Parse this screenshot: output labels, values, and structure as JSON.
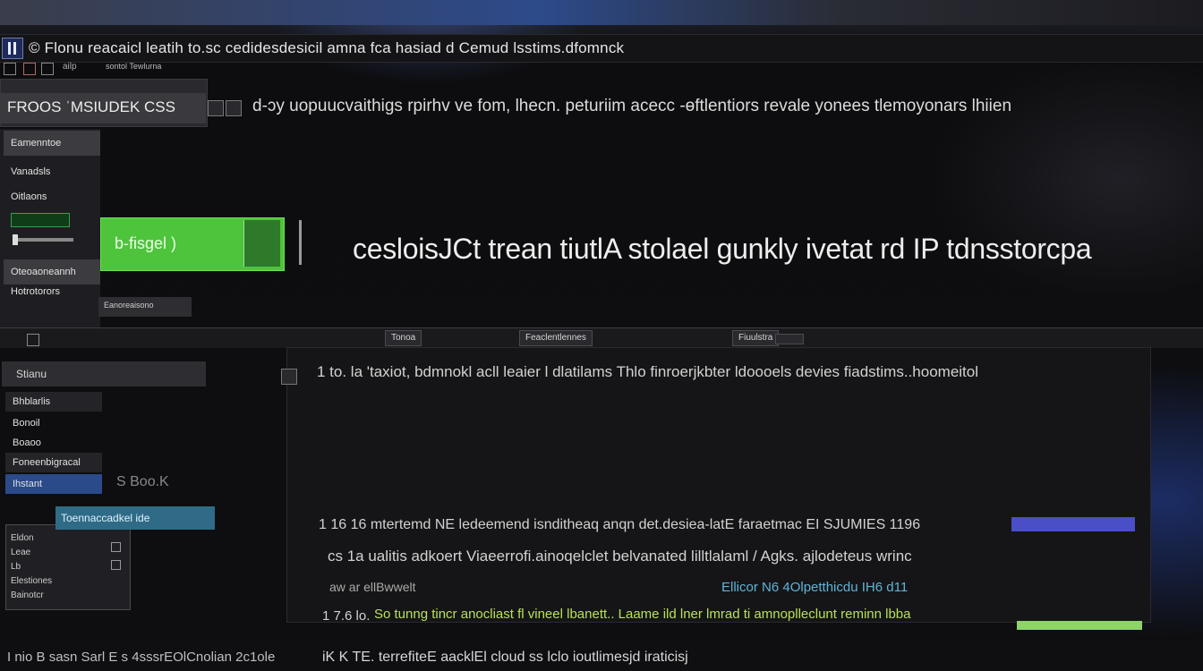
{
  "window": {
    "title": "© Flonu reacaicl leatih to.sc cedidesdesicil amna fca hasiad d Cemud lsstims.dfomnck"
  },
  "toolbar": {
    "sub_label": "sontol Tewlurna",
    "tag": "ailp",
    "title_box": "FROOS ˈMSIUDEK CSS"
  },
  "header": {
    "text": "d-ɔy uopuucvaithigs rpirhv ve fom, lhecn. peturiim acecc -ɵftlentiors revale yonees tlemoyonars lhiien"
  },
  "sidebar1": {
    "items": [
      "Eamenntoe",
      "Vanadsls",
      "Oitlaons",
      "Oteoaoneannh",
      "Hotrotorors"
    ],
    "strip_label": "Eanoreaisono"
  },
  "primary": {
    "button_label": "b-fisgel  )",
    "headline": "cesloisJCt  trean tiutlA stolael gunkly ivetat  rd  IP tdnsstorcpa"
  },
  "tabs": [
    "Tonoa",
    "Feaclentlennes",
    "Fiuulstra"
  ],
  "sidebar2": {
    "head": "Stianu",
    "items": [
      "Bhblarlis",
      "Bonoil",
      "Boaoo",
      "Foneenbigracal",
      "Ihstant"
    ],
    "badge": "S Boo.K"
  },
  "dropdown": {
    "teal_label": "Toennaccadkel ide",
    "items": [
      "Eldon",
      "Leae",
      "Lb",
      "Elestiones",
      "Bainotcr"
    ]
  },
  "main": {
    "line1": "1 to.  la 'taxiot,  bdmnokl acll leaier  l dlatilams  Thlo  finroerjkbter  ldoooels  devies  fiadstims..hoomeitol",
    "line2": "1 16  16  mtertemd NE ledeemend isnditheaq  anqn  det.desiea-latE faraetmac EI SJUMIES 1196",
    "line3": "cs  1a  ualitis adkoert  Viaeerrofi.ainoqelclet  belvanated lilltlalaml / Agks.  ajlodeteus wrinc",
    "line4_a": "aw  ar  ellBwwelt",
    "line4_b": "Ellicor   N6    4Olpetthicdu    IH6 d11",
    "line5_num": "1 7.6  lo.",
    "line5": "So tunng  tincr  anocliast fl vineel lbanett..  Laame ild lner lmrad ti  amnoplleclunt reminn lbba"
  },
  "footer": {
    "left": "I nio   B sasn  Sarl  E s  4sssrEOlCnolian   2c1ole",
    "right": "iK K  TE. terrefiteE aacklEl cloud ss   lclo  ioutlimesjd  iraticisj"
  },
  "colors": {
    "accent_green": "#4ec33c",
    "teal": "#2f6b86",
    "blue": "#4a4fc8",
    "selected": "#2a4a8a"
  }
}
